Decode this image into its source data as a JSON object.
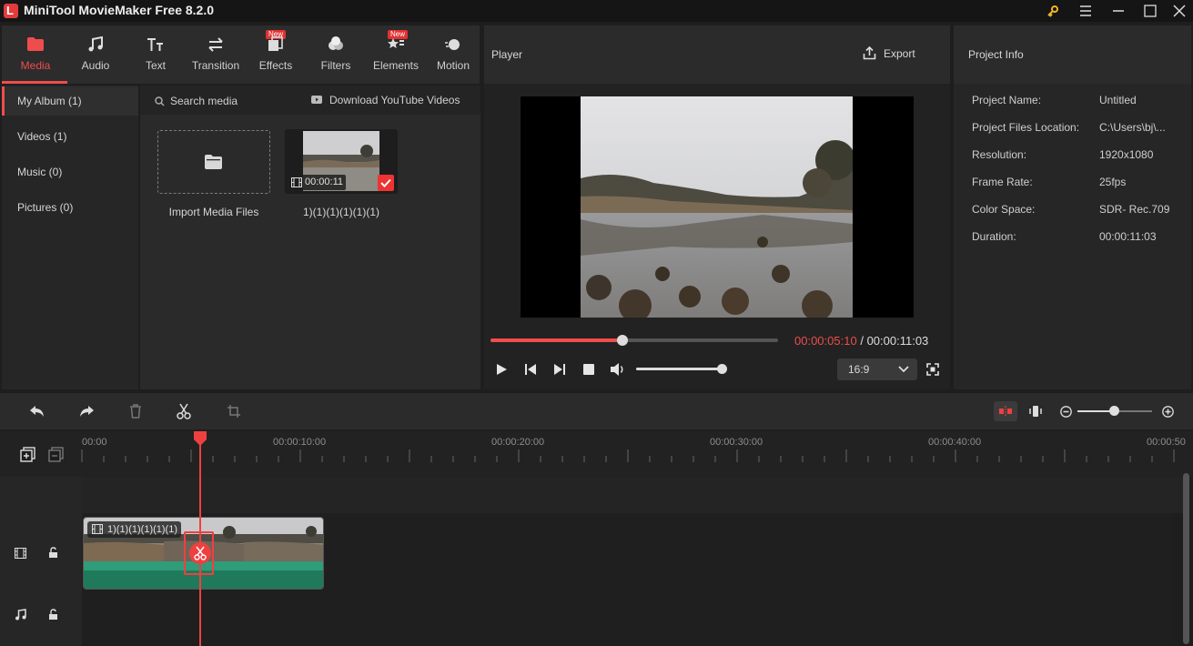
{
  "window": {
    "title": "MiniTool MovieMaker Free 8.2.0",
    "logo_letter": "L"
  },
  "toolbar": {
    "items": [
      {
        "label": "Media",
        "icon": "folder-icon",
        "active": true
      },
      {
        "label": "Audio",
        "icon": "music-note-icon"
      },
      {
        "label": "Text",
        "icon": "text-icon"
      },
      {
        "label": "Transition",
        "icon": "transition-arrows-icon"
      },
      {
        "label": "Effects",
        "icon": "effects-icon",
        "badge": "New"
      },
      {
        "label": "Filters",
        "icon": "filters-icon"
      },
      {
        "label": "Elements",
        "icon": "elements-icon",
        "badge": "New"
      },
      {
        "label": "Motion",
        "icon": "motion-icon"
      }
    ]
  },
  "sidebar": {
    "items": [
      {
        "label": "My Album (1)",
        "active": true
      },
      {
        "label": "Videos (1)"
      },
      {
        "label": "Music (0)"
      },
      {
        "label": "Pictures (0)"
      }
    ]
  },
  "media": {
    "search_label": "Search media",
    "download_label": "Download YouTube Videos",
    "import_label": "Import Media Files",
    "clip_name": "1)(1)(1)(1)(1)(1)",
    "clip_duration": "00:00:11"
  },
  "player": {
    "title": "Player",
    "export_label": "Export",
    "current_time": "00:00:05:10",
    "time_separator": "/",
    "total_time": "00:00:11:03",
    "progress": 0.46,
    "volume": 1.0,
    "aspect_ratio": "16:9"
  },
  "project_info": {
    "title": "Project Info",
    "rows": [
      {
        "key": "Project Name:",
        "value": "Untitled"
      },
      {
        "key": "Project Files Location:",
        "value": "C:\\Users\\bj\\..."
      },
      {
        "key": "Resolution:",
        "value": "1920x1080"
      },
      {
        "key": "Frame Rate:",
        "value": "25fps"
      },
      {
        "key": "Color Space:",
        "value": "SDR- Rec.709"
      },
      {
        "key": "Duration:",
        "value": "00:00:11:03"
      }
    ]
  },
  "timeline": {
    "ruler_labels": [
      "00:00",
      "00:00:10:00",
      "00:00:20:00",
      "00:00:30:00",
      "00:00:40:00",
      "00:00:50"
    ],
    "clip_label": "1)(1)(1)(1)(1)(1)",
    "zoom": 0.5
  },
  "colors": {
    "accent": "#ef4d4d",
    "audio_wave": "#2f9c7a"
  }
}
